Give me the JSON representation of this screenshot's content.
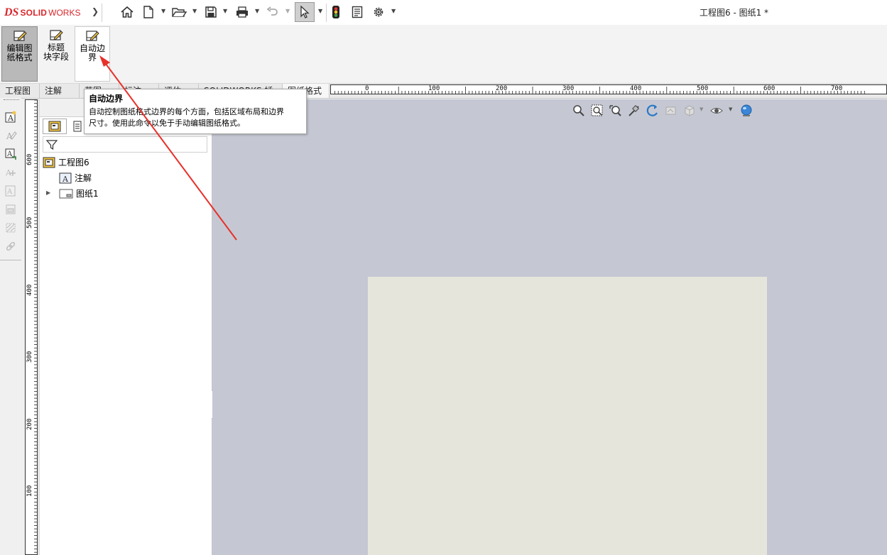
{
  "app": {
    "logo_ds": "DS",
    "logo_solid": "SOLID",
    "logo_works": "WORKS",
    "window_title": "工程图6 - 图纸1 *"
  },
  "quick_access": [
    "home-icon",
    "new-document-icon",
    "open-icon",
    "save-icon",
    "print-icon",
    "undo-icon",
    "select-pointer-icon",
    "traffic-light-icon",
    "file-properties-icon",
    "gear-icon"
  ],
  "command_manager": {
    "edit_sheet_format": {
      "line1": "编辑图",
      "line2": "纸格式"
    },
    "title_block_fields": {
      "line1": "标题",
      "line2": "块字段"
    },
    "auto_border": {
      "line1": "自动边",
      "line2": "界"
    }
  },
  "tabs": [
    "工程图",
    "注解",
    "草图",
    "标注",
    "评估",
    "SOLIDWORKS 插件",
    "图纸格式"
  ],
  "ruler_h": [
    "0",
    "100",
    "200",
    "300",
    "400",
    "500",
    "600",
    "700"
  ],
  "ruler_v": [
    "600",
    "500",
    "400",
    "300",
    "200",
    "100"
  ],
  "tooltip": {
    "title": "自动边界",
    "body_line1": "自动控制图纸格式边界的每个方面，包括区域布局和边界",
    "body_line2": "尺寸。使用此命令以免于手动编辑图纸格式。"
  },
  "tree": {
    "root": "工程图6",
    "annotations": "注解",
    "sheet": "图纸1"
  },
  "colors": {
    "brand": "#d8262b",
    "graphics_bg": "#c5c8d3",
    "sheet_bg": "#e6e5dc",
    "annotation_arrow": "#e8302a"
  }
}
